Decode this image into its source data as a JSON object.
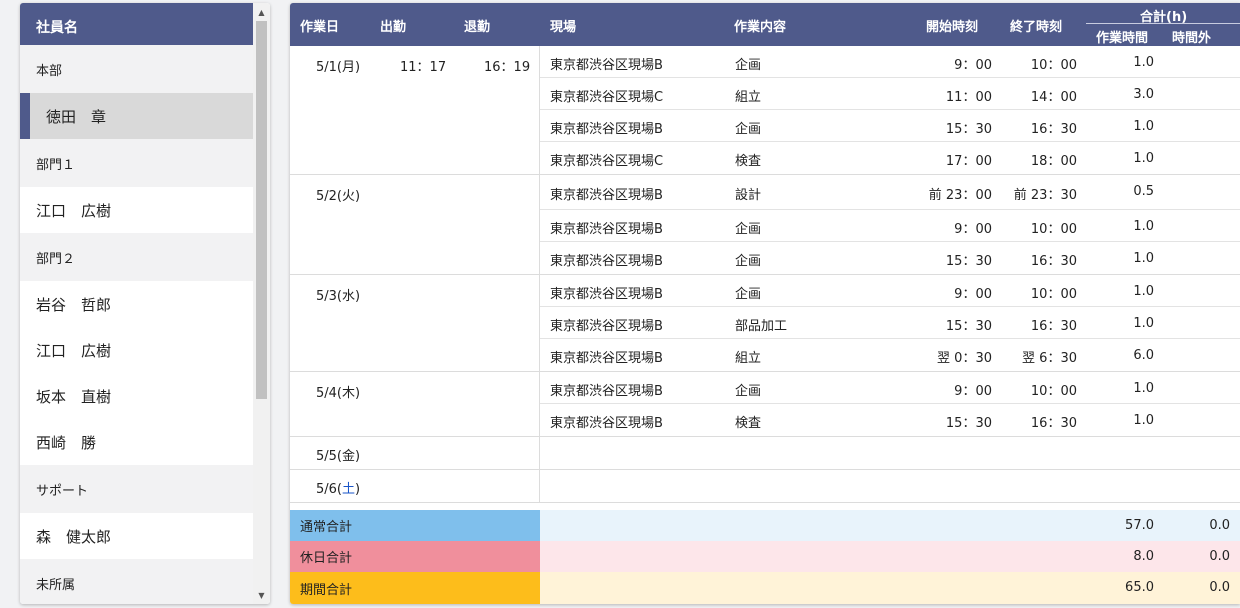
{
  "employee_panel": {
    "header": "社員名",
    "groups": [
      {
        "name": "本部",
        "members": [
          "徳田　章"
        ]
      },
      {
        "name": "部門１",
        "members": [
          "江口　広樹"
        ]
      },
      {
        "name": "部門２",
        "members": [
          "岩谷　哲郎",
          "江口　広樹",
          "坂本　直樹",
          "西崎　勝"
        ]
      },
      {
        "name": "サポート",
        "members": [
          "森　健太郎"
        ]
      },
      {
        "name": "未所属",
        "members": []
      }
    ],
    "selected": "徳田　章"
  },
  "timesheet": {
    "headers": {
      "date": "作業日",
      "clock_in": "出勤",
      "clock_out": "退勤",
      "site": "現場",
      "task": "作業内容",
      "start": "開始時刻",
      "end": "終了時刻",
      "total_group": "合計(h)",
      "work_hours": "作業時間",
      "overtime": "時間外"
    },
    "days": [
      {
        "date": "5/1(月)",
        "clock_in": "11：17",
        "clock_out": "16：19",
        "entries": [
          {
            "site": "東京都渋谷区現場B",
            "task": "企画",
            "start": "9：00",
            "end": "10：00",
            "hours": "1.0"
          },
          {
            "site": "東京都渋谷区現場C",
            "task": "組立",
            "start": "11：00",
            "end": "14：00",
            "hours": "3.0"
          },
          {
            "site": "東京都渋谷区現場B",
            "task": "企画",
            "start": "15：30",
            "end": "16：30",
            "hours": "1.0"
          },
          {
            "site": "東京都渋谷区現場C",
            "task": "検査",
            "start": "17：00",
            "end": "18：00",
            "hours": "1.0"
          }
        ]
      },
      {
        "date": "5/2(火)",
        "clock_in": "",
        "clock_out": "",
        "entries": [
          {
            "site": "東京都渋谷区現場B",
            "task": "設計",
            "start": "前 23：00",
            "end": "前 23：30",
            "hours": "0.5"
          },
          {
            "site": "東京都渋谷区現場B",
            "task": "企画",
            "start": "9：00",
            "end": "10：00",
            "hours": "1.0"
          },
          {
            "site": "東京都渋谷区現場B",
            "task": "企画",
            "start": "15：30",
            "end": "16：30",
            "hours": "1.0"
          }
        ]
      },
      {
        "date": "5/3(水)",
        "clock_in": "",
        "clock_out": "",
        "entries": [
          {
            "site": "東京都渋谷区現場B",
            "task": "企画",
            "start": "9：00",
            "end": "10：00",
            "hours": "1.0"
          },
          {
            "site": "東京都渋谷区現場B",
            "task": "部品加工",
            "start": "15：30",
            "end": "16：30",
            "hours": "1.0"
          },
          {
            "site": "東京都渋谷区現場B",
            "task": "組立",
            "start": "翌 0：30",
            "end": "翌 6：30",
            "hours": "6.0"
          }
        ]
      },
      {
        "date": "5/4(木)",
        "clock_in": "",
        "clock_out": "",
        "entries": [
          {
            "site": "東京都渋谷区現場B",
            "task": "企画",
            "start": "9：00",
            "end": "10：00",
            "hours": "1.0"
          },
          {
            "site": "東京都渋谷区現場B",
            "task": "検査",
            "start": "15：30",
            "end": "16：30",
            "hours": "1.0"
          }
        ]
      },
      {
        "date": "5/5(金)",
        "clock_in": "",
        "clock_out": "",
        "entries": []
      },
      {
        "date_prefix": "5/6(",
        "date_weekday": "土",
        "date_suffix": ")",
        "clock_in": "",
        "clock_out": "",
        "entries": []
      }
    ],
    "totals": [
      {
        "label": "通常合計",
        "work": "57.0",
        "overtime": "0.0",
        "label_bg": "#7fbfec",
        "row_bg": "#e8f3fb"
      },
      {
        "label": "休日合計",
        "work": "8.0",
        "overtime": "0.0",
        "label_bg": "#f08f9c",
        "row_bg": "#fde6ea"
      },
      {
        "label": "期間合計",
        "work": "65.0",
        "overtime": "0.0",
        "label_bg": "#fdbd1b",
        "row_bg": "#fff3d8"
      }
    ]
  },
  "colors": {
    "header_bg": "#4f5a8b",
    "saturday": "#1a55c8"
  }
}
